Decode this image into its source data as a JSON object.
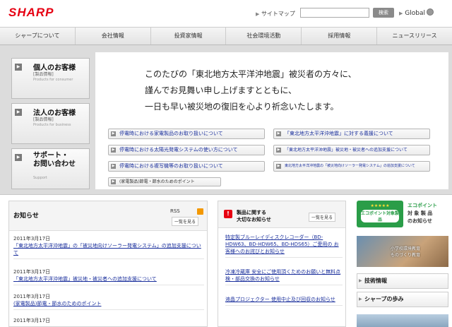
{
  "header": {
    "logo": "SHARP",
    "sitemap": "サイトマップ",
    "search_placeholder": "",
    "search_button": "検索",
    "global": "Global"
  },
  "nav": [
    "シャープについて",
    "会社情報",
    "投資家情報",
    "社会環境活動",
    "採用情報",
    "ニュースリリース"
  ],
  "hero": {
    "side_buttons": [
      {
        "title": "個人のお客様",
        "sub": "[製品情報]",
        "en": "Products for consumer"
      },
      {
        "title": "法人のお客様",
        "sub": "[製品情報]",
        "en": "Products for business"
      },
      {
        "title": "サポート・\nお問い合わせ",
        "sub": "",
        "en": "Support"
      }
    ],
    "message": [
      "このたびの「東北地方太平洋沖地震」被災者の方々に、",
      "謹んでお見舞い申し上げますとともに、",
      "一日も早い被災地の復旧を心より祈念いたします。"
    ],
    "links_left": [
      "停電時における家電製品のお取り扱いについて",
      "停電時における太陽光発電システムの使い方について",
      "停電時における複写機等のお取り扱いについて"
    ],
    "link_extra": "(家電製品)節電・節水のためのポイント",
    "links_right": [
      "「東北地方太平洋沖地震」に対する義援について",
      "「東北地方太平洋沖地震」被災地・被災者への追加支援について",
      "東北地方太平洋沖地震の「被災地向けソーラー発電システム」の追加支援について"
    ]
  },
  "news": {
    "title": "お知らせ",
    "rss": "RSS",
    "list_button": "一覧を見る",
    "items": [
      {
        "date": "2011年3月17日",
        "text": "「東北地方太平洋沖地震」の「被災地向けソーラー発電システム」の追加支援について"
      },
      {
        "date": "2011年3月17日",
        "text": "「東北地方太平洋沖地震」被災地・被災者への追加支援について"
      },
      {
        "date": "2011年3月17日",
        "text": "(家電製品)節電・節水のためのポイント"
      },
      {
        "date": "2011年3月17日",
        "text": ""
      }
    ]
  },
  "products": {
    "title": "製品に関する\n大切なお知らせ",
    "list_button": "一覧を見る",
    "items": [
      "特定製ブルーレイディスクレコーダー（BD-HDW63、BD-HDW65、BD-HDS65）ご愛用の お客様へのお詫びとお知らせ",
      "冷凍冷蔵庫 安全にご使用頂くためのお願いと無料点検・部品交換のお知らせ",
      "液晶プロジェクター 使用中止及び回収のお知らせ",
      ""
    ]
  },
  "right": {
    "eco_badge_top": "★★★★★",
    "eco_badge_label": "エコポイント対象製品",
    "eco_text": [
      "エコポイント",
      "対 象 製 品",
      "のお知らせ"
    ],
    "photo_text": [
      "小学校環境教育",
      "ものづくり教育"
    ],
    "links": [
      "技術情報",
      "シャープの歩み"
    ]
  }
}
